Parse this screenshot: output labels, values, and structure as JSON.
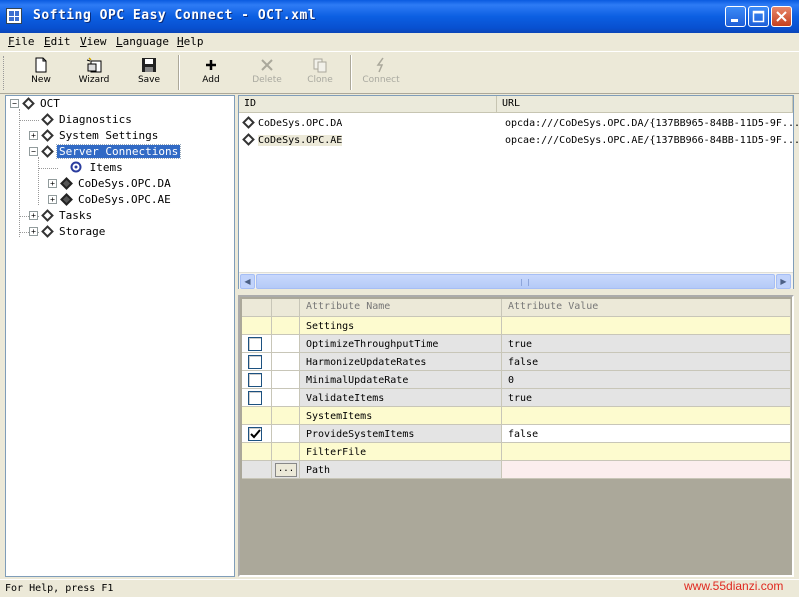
{
  "window": {
    "title": "Softing OPC Easy Connect - OCT.xml",
    "min_label": "minimize",
    "max_label": "maximize",
    "close_label": "close"
  },
  "menu": [
    {
      "key": "F",
      "rest": "ile"
    },
    {
      "key": "E",
      "rest": "dit"
    },
    {
      "key": "V",
      "rest": "iew"
    },
    {
      "key": "L",
      "rest": "anguage"
    },
    {
      "key": "H",
      "rest": "elp"
    }
  ],
  "toolbar": {
    "new": {
      "label": "New",
      "icon": "new-document-icon"
    },
    "wizard": {
      "label": "Wizard",
      "icon": "wizard-icon"
    },
    "save": {
      "label": "Save",
      "icon": "save-icon"
    },
    "add": {
      "label": "Add",
      "icon": "add-icon"
    },
    "delete": {
      "label": "Delete",
      "icon": "delete-icon",
      "enabled": false
    },
    "clone": {
      "label": "Clone",
      "icon": "clone-icon",
      "enabled": false
    },
    "connect": {
      "label": "Connect",
      "icon": "connect-icon",
      "enabled": false
    }
  },
  "tree": {
    "root": "OCT",
    "diagnostics": "Diagnostics",
    "system_settings": "System Settings",
    "server_connections": "Server Connections",
    "items": "Items",
    "da": "CoDeSys.OPC.DA",
    "ae": "CoDeSys.OPC.AE",
    "tasks": "Tasks",
    "storage": "Storage"
  },
  "list": {
    "col_id": "ID",
    "col_url": "URL",
    "rows": [
      {
        "id": "CoDeSys.OPC.DA",
        "url": "opcda:///CoDeSys.OPC.DA/{137BB965-84BB-11D5-9F..."
      },
      {
        "id": "CoDeSys.OPC.AE",
        "url": "opcae:///CoDeSys.OPC.AE/{137BB966-84BB-11D5-9F..."
      }
    ]
  },
  "grid": {
    "head_name": "Attribute Name",
    "head_value": "Attribute Value",
    "rows": [
      {
        "type": "section",
        "name": "Settings",
        "value": ""
      },
      {
        "type": "item",
        "name": "OptimizeThroughputTime",
        "value": "true",
        "checked": false
      },
      {
        "type": "item",
        "name": "HarmonizeUpdateRates",
        "value": "false",
        "checked": false
      },
      {
        "type": "item",
        "name": "MinimalUpdateRate",
        "value": "0",
        "checked": false
      },
      {
        "type": "item",
        "name": "ValidateItems",
        "value": "true",
        "checked": false
      },
      {
        "type": "section",
        "name": "SystemItems",
        "value": ""
      },
      {
        "type": "item",
        "name": "ProvideSystemItems",
        "value": "false",
        "checked": true
      },
      {
        "type": "section",
        "name": "FilterFile",
        "value": ""
      },
      {
        "type": "path",
        "name": "Path",
        "value": "",
        "button": "..."
      }
    ]
  },
  "status": {
    "text": "For Help, press F1",
    "watermark": "www.55dianzi.com"
  }
}
